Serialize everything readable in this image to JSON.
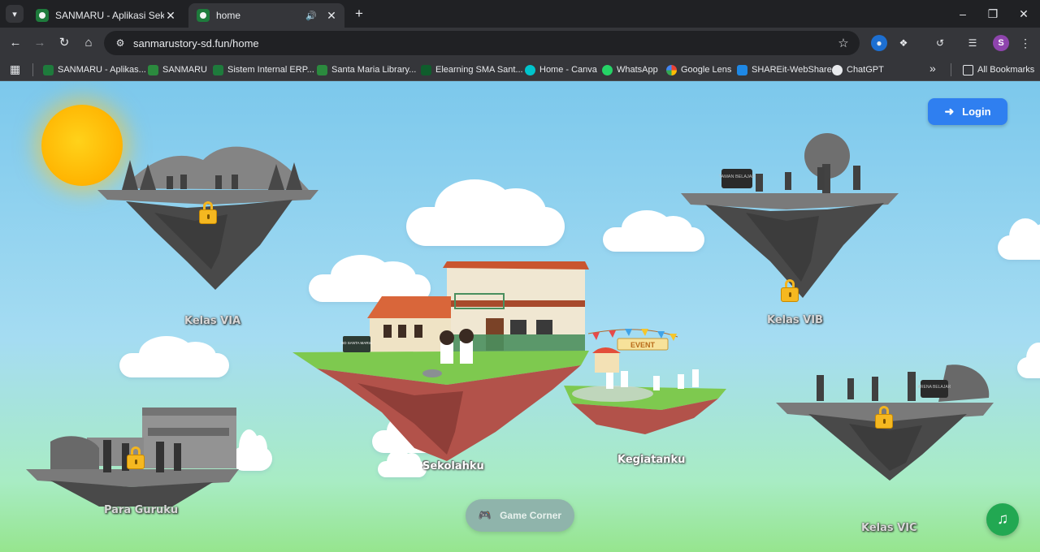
{
  "browser": {
    "tabs": [
      {
        "title": "SANMARU - Aplikasi Sekolah Sa",
        "active": false
      },
      {
        "title": "home",
        "active": true
      }
    ],
    "url": "sanmarustory-sd.fun/home",
    "profile_initial": "S",
    "bookmarks": [
      {
        "label": "SANMARU - Aplikas...",
        "color": "#1e7b3c"
      },
      {
        "label": "SANMARU",
        "color": "#2b8a3e"
      },
      {
        "label": "Sistem Internal ERP...",
        "color": "#1e7b3c"
      },
      {
        "label": "Santa Maria Library...",
        "color": "#2b8a3e"
      },
      {
        "label": "Elearning SMA Sant...",
        "color": "#0f5d2c"
      },
      {
        "label": "Home - Canva",
        "color": "#00c4cc"
      },
      {
        "label": "WhatsApp",
        "color": "#25d366"
      },
      {
        "label": "Google Lens",
        "color": "#4285f4"
      },
      {
        "label": "SHAREit-WebShare",
        "color": "#1e88e5"
      },
      {
        "label": "ChatGPT",
        "color": "#e8eaed"
      }
    ],
    "all_bookmarks": "All Bookmarks"
  },
  "page": {
    "login_label": "Login",
    "game_corner_label": "Game Corner",
    "islands": {
      "kelas_via": {
        "label": "Kelas VIA",
        "locked": true
      },
      "kelas_vib": {
        "label": "Kelas VIB",
        "locked": true
      },
      "kelas_vic": {
        "label": "Kelas VIC",
        "locked": true
      },
      "para_guruku": {
        "label": "Para Guruku",
        "locked": true
      },
      "sekolahku": {
        "label": "Sekolahku",
        "locked": false
      },
      "kegiatanku": {
        "label": "Kegiatanku",
        "locked": false
      }
    },
    "signs": {
      "school": "SD SANTA MARIA",
      "taman": "TAMAN BELAJAR",
      "event": "EVENT",
      "vic_board": "ARENA BELAJAR"
    },
    "colors": {
      "login": "#2f7ff0",
      "music": "#22a852",
      "lock": "#f5b820"
    }
  }
}
